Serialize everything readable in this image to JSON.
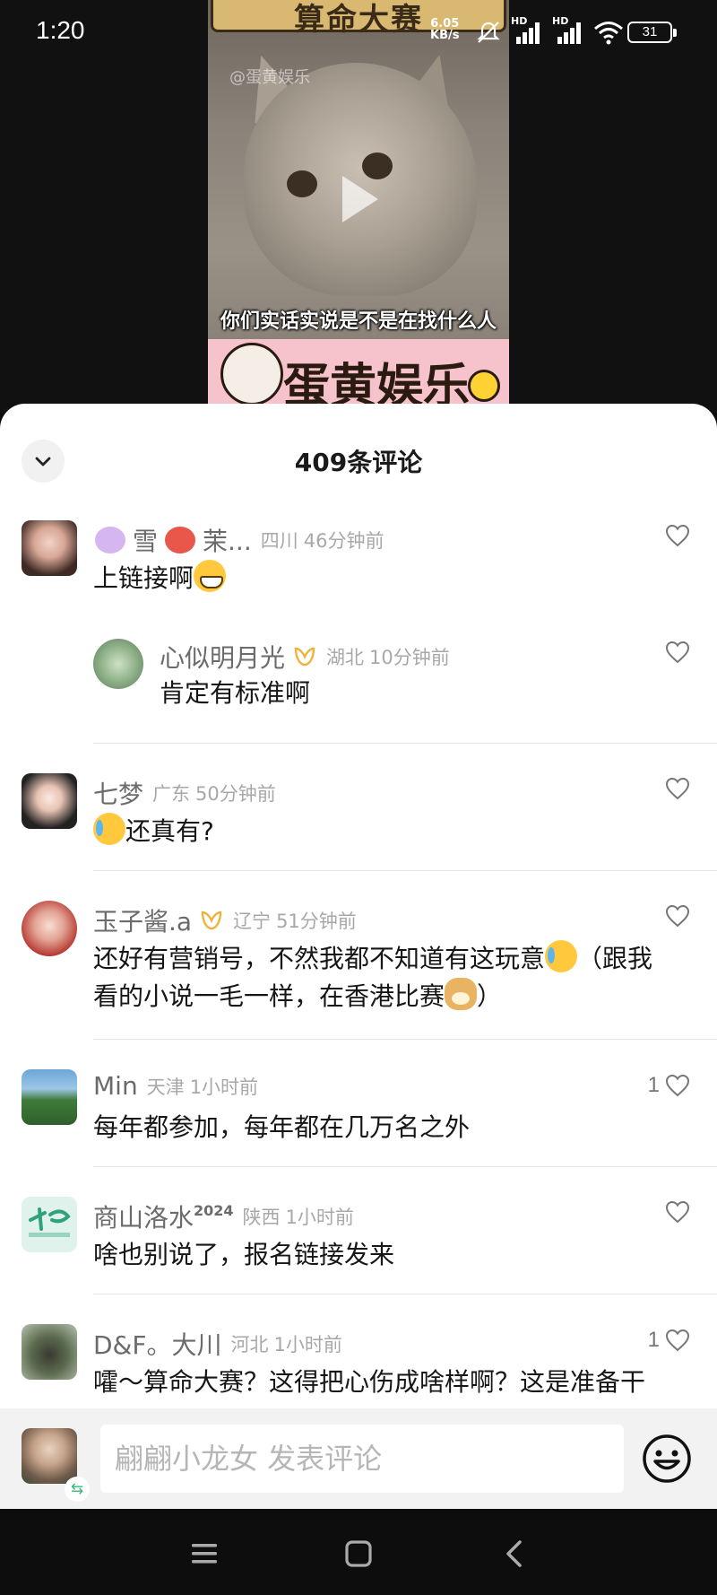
{
  "status_bar": {
    "time": "1:20",
    "net_speed_value": "6.05",
    "net_speed_unit": "KB/s",
    "hd1": "HD",
    "hd2": "HD",
    "battery": "31"
  },
  "video": {
    "banner_top": "算命大赛",
    "watermark": "@蛋黄娱乐",
    "subtitle": "你们实话实说是不是在找什么人",
    "banner_bottom": "蛋黄娱乐"
  },
  "sheet": {
    "title": "409条评论"
  },
  "comments": [
    {
      "name": "雪",
      "name2": "茉...",
      "location": "四川",
      "time": "46分钟前",
      "text": "上链接啊",
      "likes": ""
    },
    {
      "name": "心似明月光",
      "location": "湖北",
      "time": "10分钟前",
      "text": "肯定有标准啊",
      "likes": ""
    },
    {
      "name": "七梦",
      "location": "广东",
      "time": "50分钟前",
      "text": "还真有?",
      "likes": ""
    },
    {
      "name": "玉子酱.a",
      "location": "辽宁",
      "time": "51分钟前",
      "text_line1_a": "还好有营销号，不然我都不知道有这玩意",
      "text_line1_b": "（跟我",
      "text_line2_a": "看的小说一毛一样，在香港比赛",
      "text_line2_b": "）",
      "likes": ""
    },
    {
      "name": "Min",
      "location": "天津",
      "time": "1小时前",
      "text": "每年都参加，每年都在几万名之外",
      "likes": "1"
    },
    {
      "name": "商山洛水",
      "name_sup": "2024",
      "location": "陕西",
      "time": "1小时前",
      "text": "啥也别说了，报名链接发来",
      "likes": ""
    },
    {
      "name": "D&F。大川",
      "location": "河北",
      "time": "1小时前",
      "text": "嚯～算命大赛？这得把心伤成啥样啊？这是准备干",
      "likes": "1"
    }
  ],
  "input": {
    "placeholder": "翩翩小龙女 发表评论",
    "switch_icon": "⇆"
  },
  "icons": {
    "collapse": "chevron-down-icon",
    "like": "heart-outline-icon",
    "emoji": "smiley-icon",
    "nav_menu": "menu-icon",
    "nav_home": "square-home-icon",
    "nav_back": "back-chevron-icon"
  }
}
